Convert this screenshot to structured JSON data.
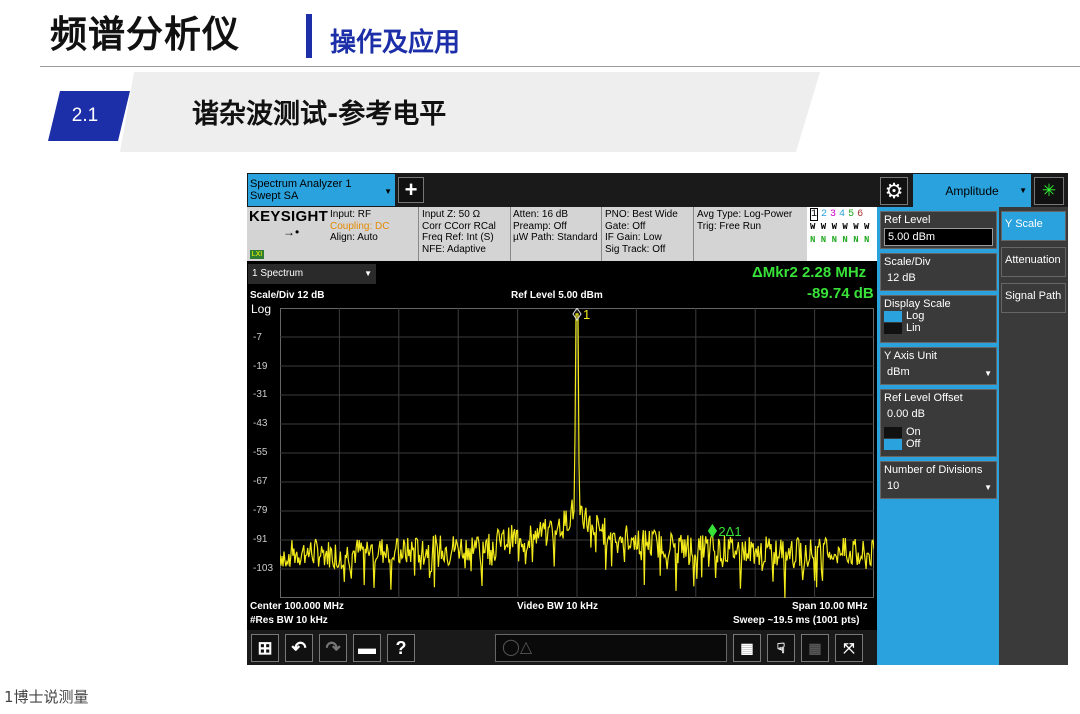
{
  "slide": {
    "title": "频谱分析仪",
    "subtitle": "操作及应用",
    "section_number": "2.1",
    "section_title": "谐杂波测试-参考电平",
    "watermark": "1博士说测量"
  },
  "topbar": {
    "app_tab_line1": "Spectrum Analyzer 1",
    "app_tab_line2": "Swept SA",
    "add_tab_label": "+",
    "menu_select": "Amplitude"
  },
  "infobar": {
    "brand": "KEYSIGHT",
    "col1": [
      "Input: RF",
      "Coupling: DC",
      "Align: Auto"
    ],
    "col2": [
      "Input Z: 50 Ω",
      "Corr CCorr RCal",
      "Freq Ref: Int (S)",
      "NFE: Adaptive"
    ],
    "col3": [
      "Atten: 16 dB",
      "Preamp: Off",
      "µW Path: Standard"
    ],
    "col4": [
      "PNO: Best Wide",
      "Gate: Off",
      "IF Gain: Low",
      "Sig Track: Off"
    ],
    "col5": [
      "Avg Type: Log-Power",
      "Trig: Free Run"
    ],
    "lxi": "LXI",
    "trace_numbers": [
      "1",
      "2",
      "3",
      "4",
      "5",
      "6"
    ],
    "trace_types": "W W W W W W",
    "trace_dets": "N N N N N N"
  },
  "display": {
    "window_tab": "1 Spectrum",
    "marker_label": "ΔMkr2  2.28 MHz",
    "marker_value": "-89.74 dB",
    "scale_div": "Scale/Div 12 dB",
    "scale_type": "Log",
    "ref_level": "Ref Level 5.00 dBm",
    "center": "Center 100.000 MHz",
    "res_bw": "#Res BW 10 kHz",
    "video_bw": "Video BW 10 kHz",
    "span": "Span 10.00 MHz",
    "sweep": "Sweep ~19.5 ms (1001 pts)",
    "marker1_tag": "1",
    "marker2_tag": "2Δ1"
  },
  "softkeys": {
    "ref_level": {
      "label": "Ref Level",
      "value": "5.00 dBm"
    },
    "scale_div": {
      "label": "Scale/Div",
      "value": "12 dB"
    },
    "display_scale": {
      "label": "Display Scale",
      "opt1": "Log",
      "opt2": "Lin",
      "selected": "Log"
    },
    "y_axis_unit": {
      "label": "Y Axis Unit",
      "value": "dBm"
    },
    "ref_offset": {
      "label": "Ref Level Offset",
      "value": "0.00 dB",
      "opt1": "On",
      "opt2": "Off",
      "selected": "Off"
    },
    "num_divisions": {
      "label": "Number of Divisions",
      "value": "10"
    }
  },
  "tabs": [
    "Y Scale",
    "Attenuation",
    "Signal Path"
  ],
  "colors": {
    "accent_blue": "#2aa2dd",
    "trace_yellow": "#f2ea1a",
    "marker_green": "#38e238",
    "slide_blue": "#1c2fa8"
  },
  "chart_data": {
    "type": "line",
    "x_unit": "MHz",
    "y_unit": "dBm",
    "xlim": [
      95.0,
      105.0
    ],
    "ylim": [
      -115.0,
      5.0
    ],
    "yticks": [
      -7.0,
      -19.0,
      -31.0,
      -43.0,
      -55.0,
      -67.0,
      -79.0,
      -91.0,
      -103
    ],
    "series": [
      {
        "x": [
          95.0,
          95.5,
          96.0,
          96.5,
          97.0,
          97.5,
          98.0,
          98.5,
          99.0,
          99.5,
          99.8,
          99.95,
          100.0,
          100.05,
          100.2,
          100.5,
          101.0,
          101.5,
          102.0,
          102.28,
          102.5,
          103.0,
          103.5,
          104.0,
          104.5,
          105.0
        ],
        "y": [
          -97,
          -96,
          -97,
          -95,
          -96,
          -95,
          -94,
          -93,
          -90,
          -88,
          -84,
          -78,
          2.5,
          -78,
          -84,
          -88,
          -91,
          -93,
          -94,
          -94,
          -95,
          -95,
          -96,
          -96,
          -96,
          -97
        ]
      }
    ],
    "markers": [
      {
        "label": "1",
        "x": 100.0,
        "y": 2.5
      },
      {
        "label": "2Δ1",
        "x": 102.28,
        "y": -87.2
      }
    ],
    "grid": true
  }
}
